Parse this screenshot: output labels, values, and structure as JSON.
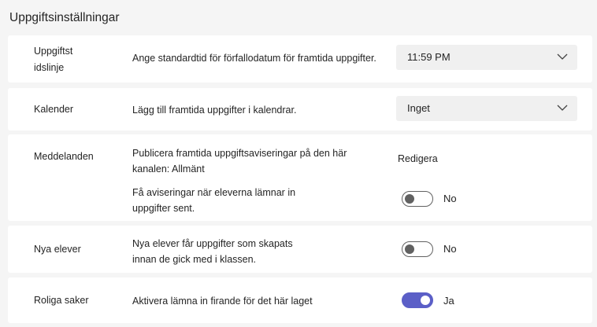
{
  "page": {
    "title": "Uppgiftsinställningar"
  },
  "timeline": {
    "label_line1": "Uppgiftst",
    "label_line2": "idslinje",
    "description": "Ange standardtid för förfallodatum för framtida uppgifter.",
    "selected": "11:59 PM"
  },
  "calendar": {
    "label": "Kalender",
    "description": "Lägg till framtida uppgifter i kalendrar.",
    "selected": "Inget"
  },
  "notifications": {
    "label": "Meddelanden",
    "publish_line1": "Publicera framtida uppgiftsaviseringar på den här",
    "publish_line2": "kanalen: Allmänt",
    "edit_link": "Redigera",
    "late_line1": "Få aviseringar när eleverna lämnar in",
    "late_line2": "uppgifter sent.",
    "late_toggle": {
      "on": false,
      "state_label": "No"
    }
  },
  "new_students": {
    "label": "Nya elever",
    "desc_line1": "Nya elever får uppgifter som skapats",
    "desc_line2": "innan de gick med i klassen.",
    "toggle": {
      "on": false,
      "state_label": "No"
    }
  },
  "fun_stuff": {
    "label": "Roliga saker",
    "description": "Aktivera lämna in firande för det här laget",
    "toggle": {
      "on": true,
      "state_label": "Ja"
    }
  },
  "colors": {
    "accent": "#5b5fc7",
    "background": "#f5f5f5",
    "card": "#ffffff",
    "dropdown": "#f0f0f0"
  },
  "icons": {
    "dropdown": "chevron-down-icon"
  }
}
